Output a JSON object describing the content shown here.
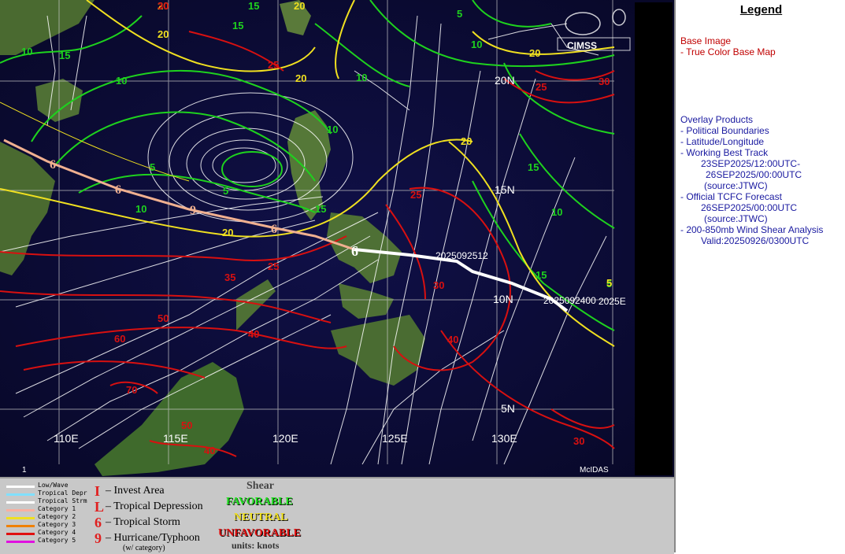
{
  "legend": {
    "title": "Legend",
    "base_image_heading": "Base Image",
    "base_image_item": "-  True Color Base Map",
    "overlay_heading": "Overlay Products",
    "overlay_items": [
      "-  Political Boundaries",
      "-  Latitude/Longitude",
      "-  Working Best Track",
      "23SEP2025/12:00UTC-",
      "26SEP2025/00:00UTC",
      "(source:JTWC)",
      "-  Official TCFC Forecast",
      "26SEP2025/00:00UTC",
      "(source:JTWC)",
      "-  200-850mb Wind Shear Analysis",
      "Valid:20250926/0300UTC"
    ]
  },
  "map": {
    "logo_text": "CIMSS",
    "footer_left": "1",
    "footer_right": "McIDAS",
    "lon_labels": [
      "110E",
      "115E",
      "120E",
      "125E",
      "130E"
    ],
    "lat_labels": [
      "20N",
      "15N",
      "10N",
      "5N"
    ],
    "track_labels": [
      "2025092512",
      "2025092400",
      "2025E"
    ],
    "contour_labels": {
      "green": [
        "10",
        "15",
        "15",
        "10",
        "5",
        "10",
        "5",
        "10",
        "15",
        "10",
        "10",
        "15",
        "15",
        "5",
        "5",
        "15",
        "10"
      ],
      "yellow": [
        "20",
        "20",
        "20",
        "20",
        "20",
        "20",
        "20",
        "5"
      ],
      "red": [
        "25",
        "25",
        "30",
        "25",
        "35",
        "25",
        "30",
        "50",
        "40",
        "60",
        "40",
        "70",
        "30",
        "40",
        "50",
        "30"
      ]
    },
    "colors": {
      "green": "#1ed21e",
      "yellow": "#f0e020",
      "red": "#d81010",
      "streamline": "#ffffff",
      "track": "#ffffff",
      "forecast": "#f0b090"
    }
  },
  "key": {
    "track_types": [
      {
        "label": "Low/Wave",
        "color": "#ffffff"
      },
      {
        "label": "Tropical Depr",
        "color": "#80e0ff"
      },
      {
        "label": "Tropical Strm",
        "color": "#ffffff"
      },
      {
        "label": "Category 1",
        "color": "#f8b0a0"
      },
      {
        "label": "Category 2",
        "color": "#f0e020"
      },
      {
        "label": "Category 3",
        "color": "#f08000"
      },
      {
        "label": "Category 4",
        "color": "#e01010"
      },
      {
        "label": "Category 5",
        "color": "#e010e0"
      }
    ],
    "symbols": [
      {
        "glyph": "I",
        "label": "– Invest Area"
      },
      {
        "glyph": "L",
        "label": "– Tropical Depression"
      },
      {
        "glyph": "6",
        "label": "– Tropical Storm"
      },
      {
        "glyph": "9",
        "label": "– Hurricane/Typhoon"
      }
    ],
    "symbol_note": "(w/ category)",
    "shear_title": "Shear",
    "favorable": "FAVORABLE",
    "neutral": "NEUTRAL",
    "unfavorable": "UNFAVORABLE",
    "units": "units: knots"
  }
}
